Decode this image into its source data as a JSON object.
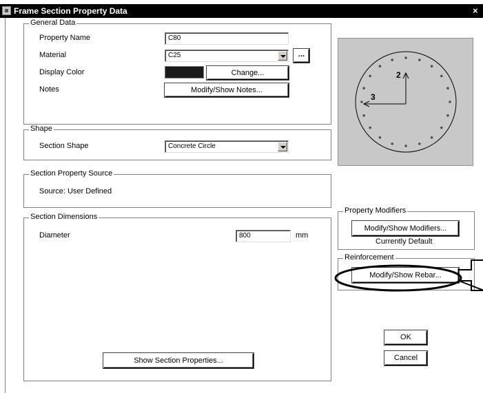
{
  "window": {
    "title": "Frame Section Property Data",
    "close_glyph": "×"
  },
  "general": {
    "legend": "General Data",
    "property_name_label": "Property Name",
    "property_name_value": "C80",
    "material_label": "Material",
    "material_value": "C25",
    "material_more": "...",
    "display_color_label": "Display Color",
    "display_color_value": "#1a1a1a",
    "change_button": "Change...",
    "notes_label": "Notes",
    "notes_button": "Modify/Show Notes..."
  },
  "shape": {
    "legend": "Shape",
    "section_shape_label": "Section Shape",
    "section_shape_value": "Concrete Circle"
  },
  "source": {
    "legend": "Section Property Source",
    "text": "Source:  User Defined"
  },
  "dimensions": {
    "legend": "Section Dimensions",
    "diameter_label": "Diameter",
    "diameter_value": "800",
    "diameter_unit": "mm",
    "show_properties_button": "Show Section Properties..."
  },
  "preview": {
    "axis_2_label": "2",
    "axis_3_label": "3",
    "background": "#c8c8c8"
  },
  "modifiers": {
    "legend": "Property Modifiers",
    "button": "Modify/Show Modifiers...",
    "status": "Currently Default"
  },
  "reinforcement": {
    "legend": "Reinforcement",
    "button": "Modify/Show Rebar..."
  },
  "actions": {
    "ok": "OK",
    "cancel": "Cancel"
  },
  "icons": {
    "app": "app-icon",
    "close": "close-icon",
    "combo": "chevron-down-icon",
    "annotation": "right-arrow-annotation-icon"
  }
}
